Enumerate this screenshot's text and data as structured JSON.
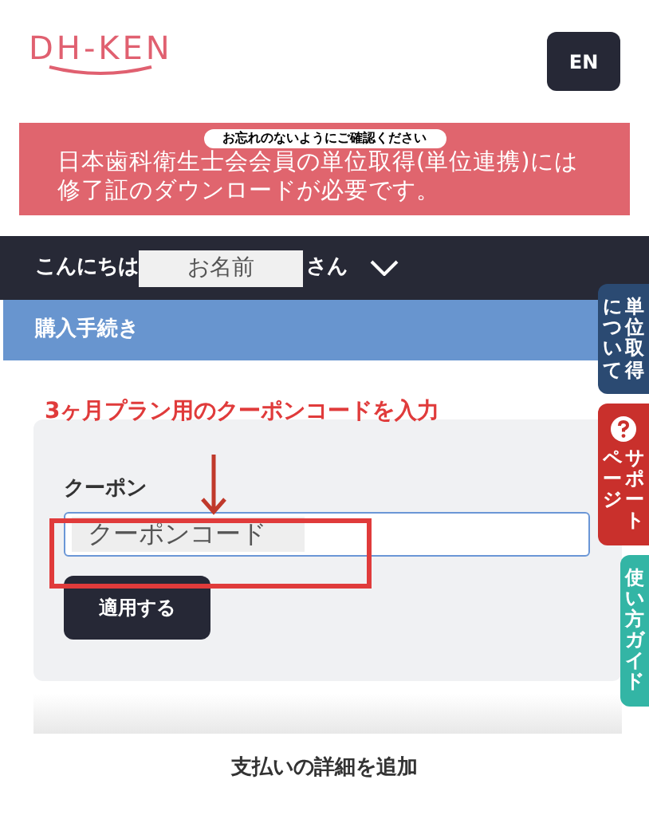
{
  "header": {
    "logo": "DH-KEN",
    "language_button": "EN"
  },
  "notice": {
    "badge": "お忘れのないようにご確認ください",
    "message": "日本歯科衛生士会会員の単位取得(単位連携)には修了証のダウンロードが必要です。"
  },
  "user_bar": {
    "greeting": "こんにちは",
    "name": "お名前",
    "suffix": "さん"
  },
  "section_title": "購入手続き",
  "side_tabs": [
    {
      "kind": "plain",
      "color": "#2b4a72",
      "lines": [
        "について",
        "単位取得"
      ]
    },
    {
      "kind": "help",
      "color": "#c9302c",
      "lines": [
        "ページ",
        "サポート"
      ]
    },
    {
      "kind": "plain",
      "color": "#33b5a5",
      "lines": [
        "使い方ガイド"
      ]
    }
  ],
  "annotation": "3ヶ月プラン用のクーポンコードを入力",
  "coupon": {
    "label": "クーポン",
    "placeholder": "クーポンコード",
    "apply_button": "適用する"
  },
  "footer": "支払いの詳細を追加"
}
